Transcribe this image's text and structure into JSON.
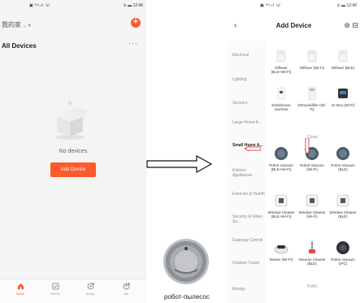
{
  "left_phone": {
    "status": {
      "left": "▣ ᴴᵈ.ıl ☏",
      "right": "⊙ ▬ 12:46"
    },
    "home_title": "我的家 ..",
    "caret": "▾",
    "add_symbol": "+",
    "section_title": "All Devices",
    "more": "···",
    "empty_text": "No devices",
    "add_button": "Add Device",
    "nav": [
      {
        "label": "Home",
        "icon": "home-icon"
      },
      {
        "label": "Scene",
        "icon": "scene-icon"
      },
      {
        "label": "Smart",
        "icon": "smart-icon"
      },
      {
        "label": "Me",
        "icon": "me-icon"
      }
    ],
    "accent": "#ff5a2c"
  },
  "caption": "робот-пылесос",
  "right_phone": {
    "status": {
      "left": "▣ ᴴᵈ.ıl ☏",
      "right": "⊙ ▬ 12:46"
    },
    "back": "‹",
    "title": "Add Device",
    "header_icons": "⊚ ⊟",
    "categories": [
      "Electrical",
      "Lighting",
      "Sensors",
      "Large Home A...",
      "Small Home A...",
      "Kitchen Appliances",
      "Exercise & Health",
      "Security & Video Su...",
      "Gateway Control",
      "Outdoor Travel",
      "Energy"
    ],
    "active_category": 4,
    "devices": [
      {
        "name": "Diffuser (BLE+Wi-Fi)",
        "icon": "diffuser-icon"
      },
      {
        "name": "Diffuser (Wi-Fi)",
        "icon": "diffuser-icon"
      },
      {
        "name": "Diffuser (BLE)",
        "icon": "diffuser-icon"
      },
      {
        "name": "Disinfection machine",
        "icon": "disinfection-icon"
      },
      {
        "name": "Dehumidifier (Wi-Fi)",
        "icon": "dehumidifier-icon"
      },
      {
        "name": "Air Box (Wi-Fi)",
        "icon": "airbox-icon"
      },
      {
        "name": "Robot Vacuum (BLE+Wi-Fi)",
        "icon": "robot-vacuum-icon"
      },
      {
        "name": "Robot Vacuum (Wi-Fi)",
        "icon": "robot-vacuum-icon"
      },
      {
        "name": "Robot Vacuum (BLE)",
        "icon": "robot-vacuum-icon"
      },
      {
        "name": "Window Cleaner (BLE+Wi-Fi)",
        "icon": "window-cleaner-icon"
      },
      {
        "name": "Window Cleaner (Wi-Fi)",
        "icon": "window-cleaner-icon"
      },
      {
        "name": "Window Cleaner (BLE)",
        "icon": "window-cleaner-icon"
      },
      {
        "name": "Mower (Wi-Fi)",
        "icon": "mower-icon"
      },
      {
        "name": "Vacuum Cleaner (BLE)",
        "icon": "vacuum-cleaner-icon"
      },
      {
        "name": "Robot Vacuum (IPC)",
        "icon": "robot-vacuum-icon"
      }
    ],
    "section_clean": "Clean",
    "section_hvac": "HVAC"
  }
}
